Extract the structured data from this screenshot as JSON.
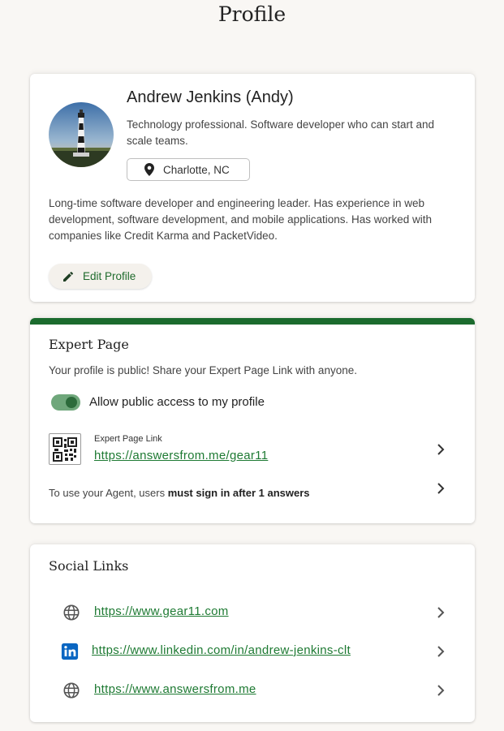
{
  "page": {
    "title": "Profile"
  },
  "profile": {
    "name": "Andrew Jenkins (Andy)",
    "headline": "Technology professional. Software developer who can start and scale teams.",
    "location": "Charlotte, NC",
    "bio": "Long-time software developer and engineering leader. Has experience in web development, software development, and mobile applications. Has worked with companies like Credit Karma and PacketVideo.",
    "edit_label": "Edit Profile",
    "location_icon": "location-pin-icon",
    "edit_icon": "pencil-icon"
  },
  "expert": {
    "title": "Expert Page",
    "description": "Your profile is public! Share your Expert Page Link with anyone.",
    "toggle_label": "Allow public access to my profile",
    "toggle_on": true,
    "link_caption": "Expert Page Link",
    "link_url": "https://answersfrom.me/gear11",
    "agent_note_prefix": "To use your Agent, users ",
    "agent_note_bold": "must sign in after 1 answers",
    "qr_icon": "qr-code-icon"
  },
  "social": {
    "title": "Social Links",
    "links": [
      {
        "url": "https://www.gear11.com",
        "icon": "globe-icon"
      },
      {
        "url": "https://www.linkedin.com/in/andrew-jenkins-clt",
        "icon": "linkedin-icon"
      },
      {
        "url": "https://www.answersfrom.me",
        "icon": "globe-icon"
      }
    ]
  },
  "colors": {
    "accent": "#1b6b2e",
    "link": "#1e7a33",
    "background": "#f9f7f4"
  }
}
